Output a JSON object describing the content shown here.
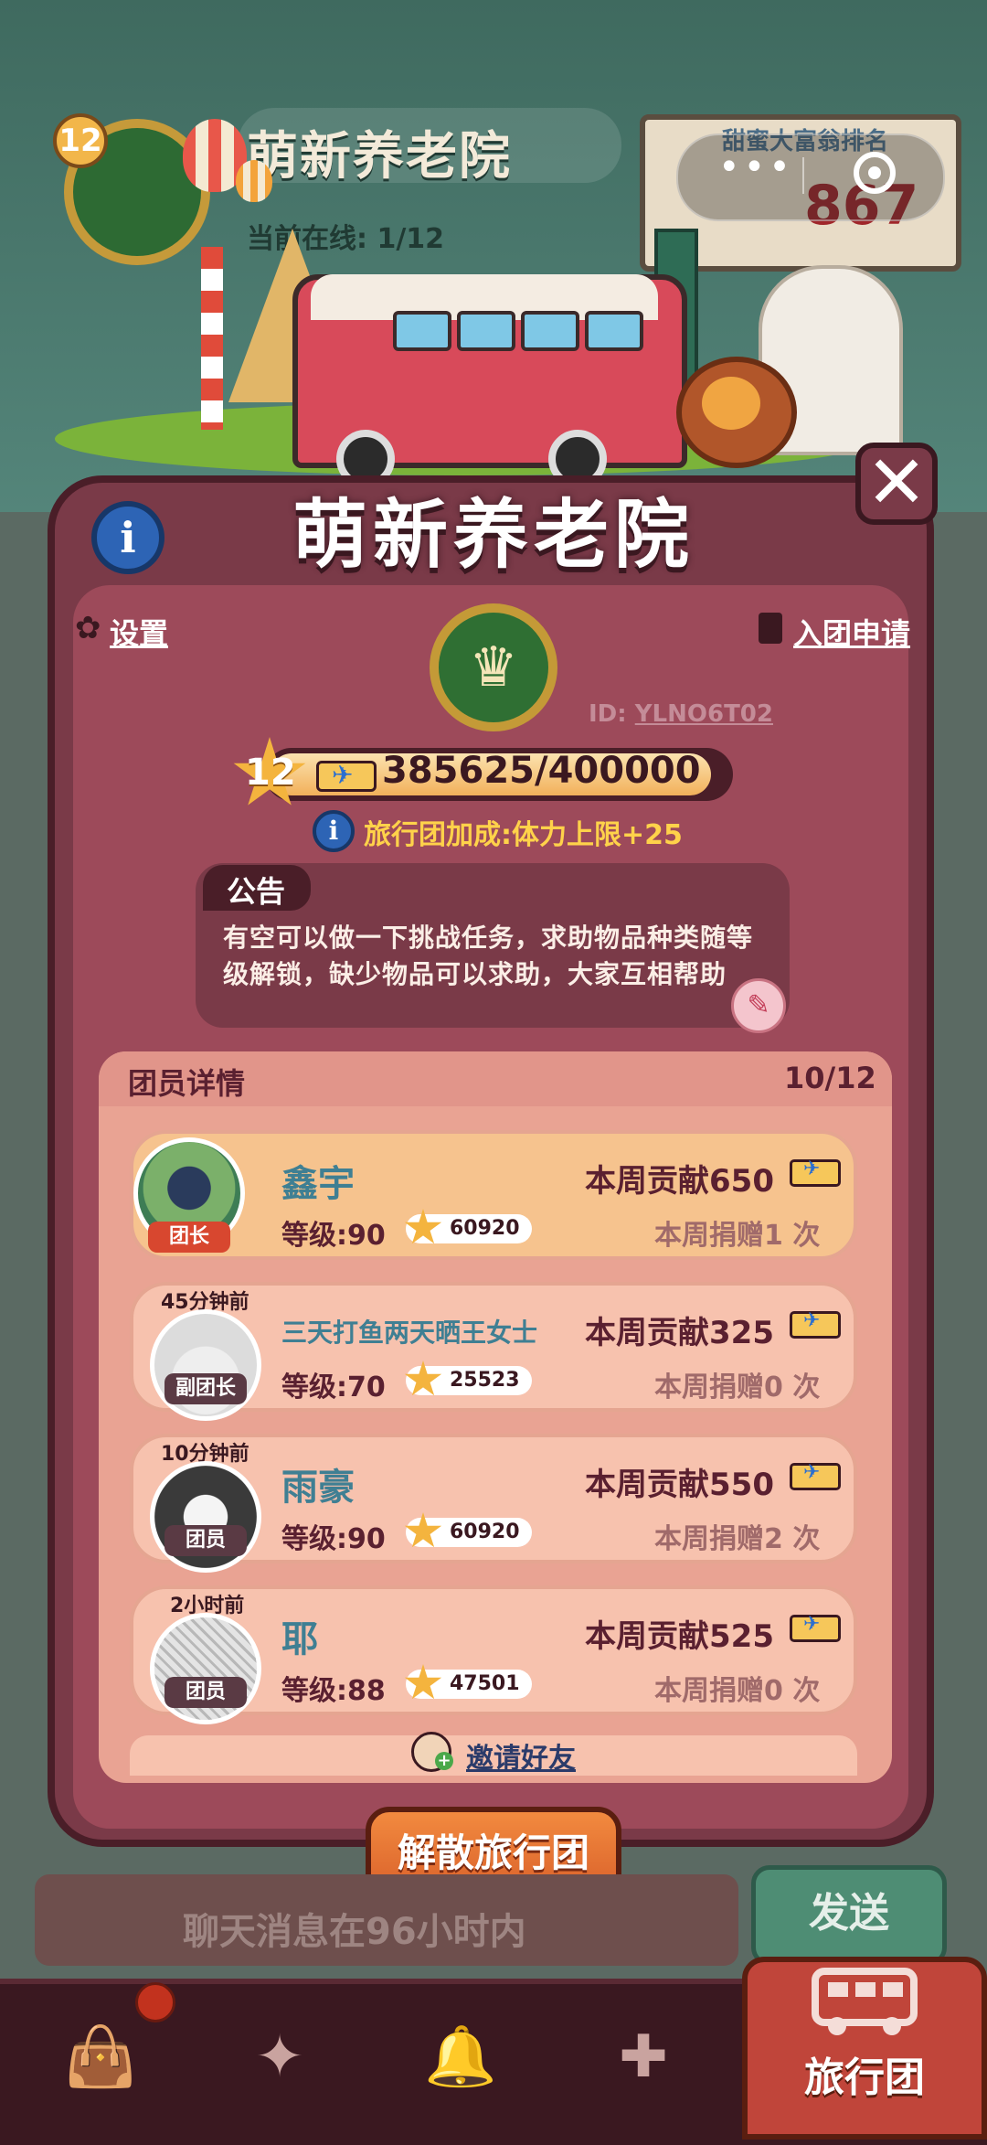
{
  "background": {
    "group_name": "萌新养老院",
    "online_label": "当前在线: 1/12",
    "level": "12",
    "rank_title": "甜蜜大富翁排名",
    "rank_number": "867"
  },
  "wechat_capsule": {
    "more_icon": "more-dots-icon",
    "close_icon": "target-circle-icon"
  },
  "modal": {
    "title": "萌新养老院",
    "settings_label": "设置",
    "apply_label": "入团申请",
    "id_prefix": "ID:",
    "id_value": "YLNO6T02",
    "level": "12",
    "xp_text": "385625/400000",
    "xp_progress": 0.964,
    "bonus_text": "旅行团加成:体力上限+25",
    "notice_title": "公告",
    "notice_text": "有空可以做一下挑战任务，求助物品种类随等级解锁，缺少物品可以求助，大家互相帮助",
    "members_title": "团员详情",
    "members_count": "10/12",
    "invite_label": "邀请好友",
    "disband_label": "解散旅行团"
  },
  "members": [
    {
      "name": "鑫宇",
      "role": "团长",
      "last_seen": "",
      "level": "等级:90",
      "stars": "60920",
      "contribution": "本周贡献650",
      "donations": "本周捐赠1 次"
    },
    {
      "name": "三天打鱼两天晒王女士",
      "role": "副团长",
      "last_seen": "45分钟前",
      "level": "等级:70",
      "stars": "25523",
      "contribution": "本周贡献325",
      "donations": "本周捐赠0 次"
    },
    {
      "name": "雨豪",
      "role": "团员",
      "last_seen": "10分钟前",
      "level": "等级:90",
      "stars": "60920",
      "contribution": "本周贡献550",
      "donations": "本周捐赠2 次"
    },
    {
      "name": "耶",
      "role": "团员",
      "last_seen": "2小时前",
      "level": "等级:88",
      "stars": "47501",
      "contribution": "本周贡献525",
      "donations": "本周捐赠0 次"
    }
  ],
  "chat": {
    "placeholder": "聊天消息在96小时内",
    "send_label": "发送"
  },
  "bottom_nav": {
    "items": [
      "shop-bag-icon",
      "puzzle-pieces-icon",
      "service-bell-icon",
      "map-pin-icon"
    ],
    "active_label": "旅行团"
  },
  "colors": {
    "modal": "#7a3a48",
    "panel": "#e9a393",
    "accent": "#f28a3f",
    "info_blue": "#2d64b5",
    "name_teal": "#3f7f93"
  }
}
